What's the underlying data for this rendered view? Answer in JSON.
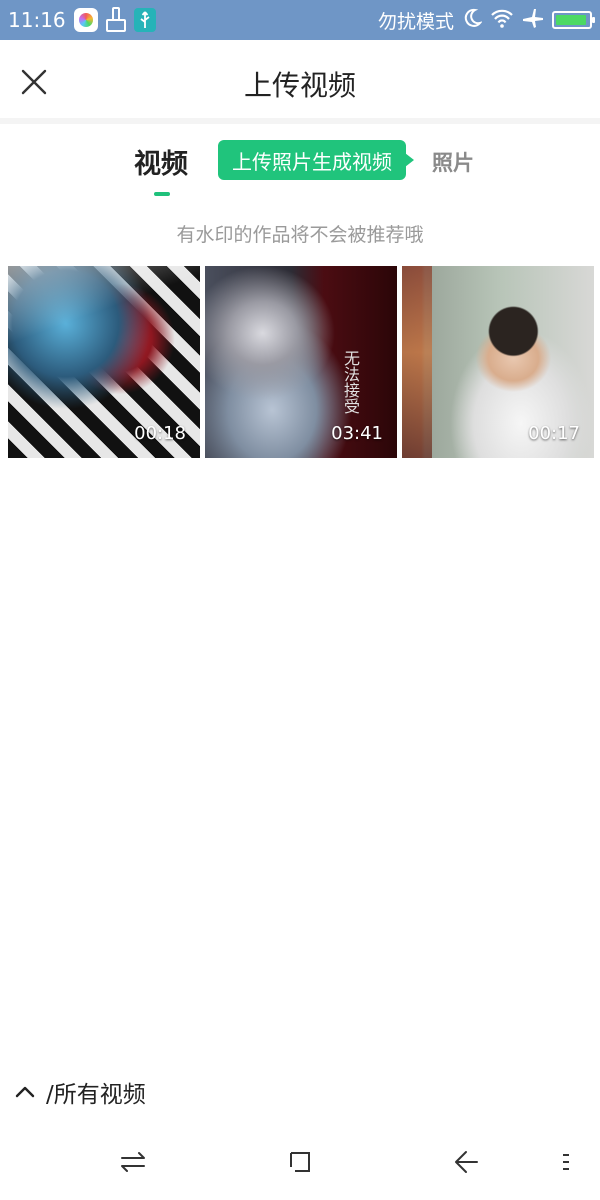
{
  "status_bar": {
    "time": "11:16",
    "dnd_text": "勿扰模式",
    "icons": [
      "app-notification-icon",
      "brush-icon",
      "usb-icon",
      "moon-icon",
      "wifi-icon",
      "airplane-icon",
      "battery-icon"
    ],
    "battery_level": 0.95,
    "background_color": "#6f96c6"
  },
  "header": {
    "title": "上传视频",
    "close_icon": "close-icon"
  },
  "tabs": {
    "video_label": "视频",
    "promo_label": "上传照片生成视频",
    "photo_label": "照片",
    "accent_color": "#20c47c"
  },
  "notice": "有水印的作品将不会被推荐哦",
  "videos": [
    {
      "duration": "00:18"
    },
    {
      "duration": "03:41",
      "poster_text": "无法接受"
    },
    {
      "duration": "00:17"
    }
  ],
  "album": {
    "icon": "chevron-up-icon",
    "label": "/所有视频"
  },
  "nav_bar": {
    "icons": [
      "recent-apps-icon",
      "home-icon",
      "back-icon",
      "menu-icon"
    ]
  }
}
